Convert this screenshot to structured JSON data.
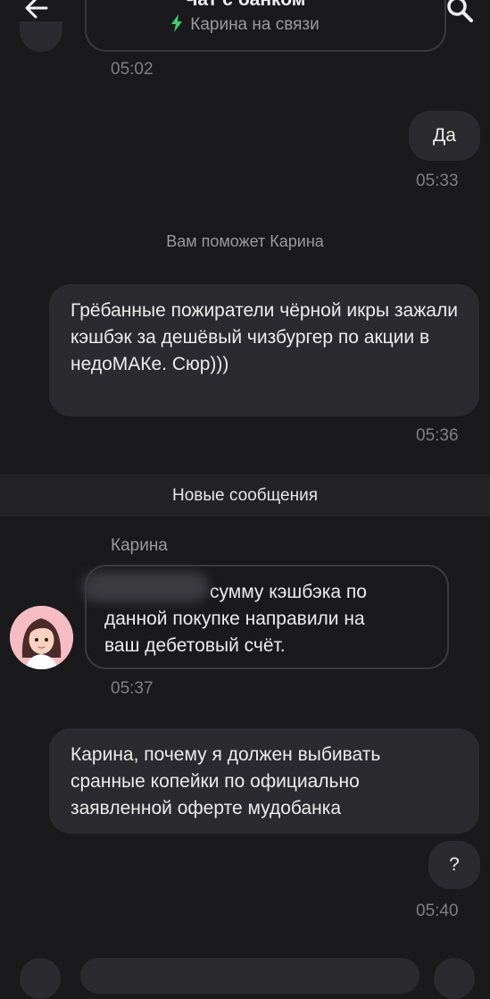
{
  "header": {
    "title": "Чат с банком",
    "status": "Карина на связи"
  },
  "messages": {
    "prev_time": "05:02",
    "out1": {
      "text": "Да",
      "time": "05:33"
    },
    "system_assign": "Вам поможет Карина",
    "out2": {
      "text": "Грёбанные пожиратели чёрной икры зажали кэшбэк за дешёвый чизбургер по акции в недоМАКе. Сюр)))",
      "time": "05:36"
    },
    "new_divider": "Новые сообщения",
    "agent": {
      "name": "Карина",
      "line1": "сумму кэшбэка по",
      "line2": "данной покупке направили на",
      "line3": "ваш дебетовый счёт.",
      "time": "05:37"
    },
    "out3": {
      "text": "Карина, почему я должен выбивать сранные копейки по официально заявленной оферте мудобанка"
    },
    "out4": {
      "text": "?",
      "time": "05:40"
    }
  },
  "icons": {
    "back": "arrow-left-icon",
    "search": "search-icon",
    "status": "lightning-icon"
  },
  "colors": {
    "background": "#1a1a1c",
    "bubble": "#2b2b2f",
    "online_green": "#3ecf6a"
  }
}
